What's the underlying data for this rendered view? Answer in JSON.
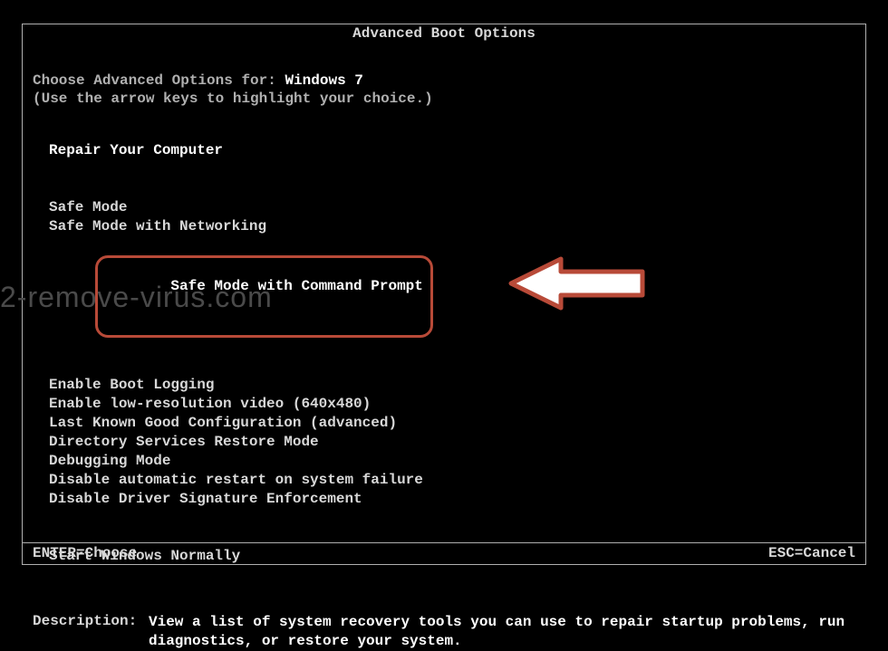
{
  "title": "Advanced Boot Options",
  "prompt": {
    "prefix": "Choose Advanced Options for: ",
    "os": "Windows 7",
    "hint": "(Use the arrow keys to highlight your choice.)"
  },
  "menu": {
    "group1": [
      "Repair Your Computer"
    ],
    "group2": [
      "Safe Mode",
      "Safe Mode with Networking",
      "Safe Mode with Command Prompt"
    ],
    "group3": [
      "Enable Boot Logging",
      "Enable low-resolution video (640x480)",
      "Last Known Good Configuration (advanced)",
      "Directory Services Restore Mode",
      "Debugging Mode",
      "Disable automatic restart on system failure",
      "Disable Driver Signature Enforcement"
    ],
    "group4": [
      "Start Windows Normally"
    ]
  },
  "description": {
    "label": "Description:",
    "text": "View a list of system recovery tools you can use to repair startup problems, run diagnostics, or restore your system."
  },
  "footer": {
    "enter": "ENTER=Choose",
    "esc": "ESC=Cancel"
  },
  "watermark": "2-remove-virus.com",
  "annotation": {
    "highlighted_item": "Safe Mode with Command Prompt",
    "arrow_icon": "left-arrow"
  }
}
